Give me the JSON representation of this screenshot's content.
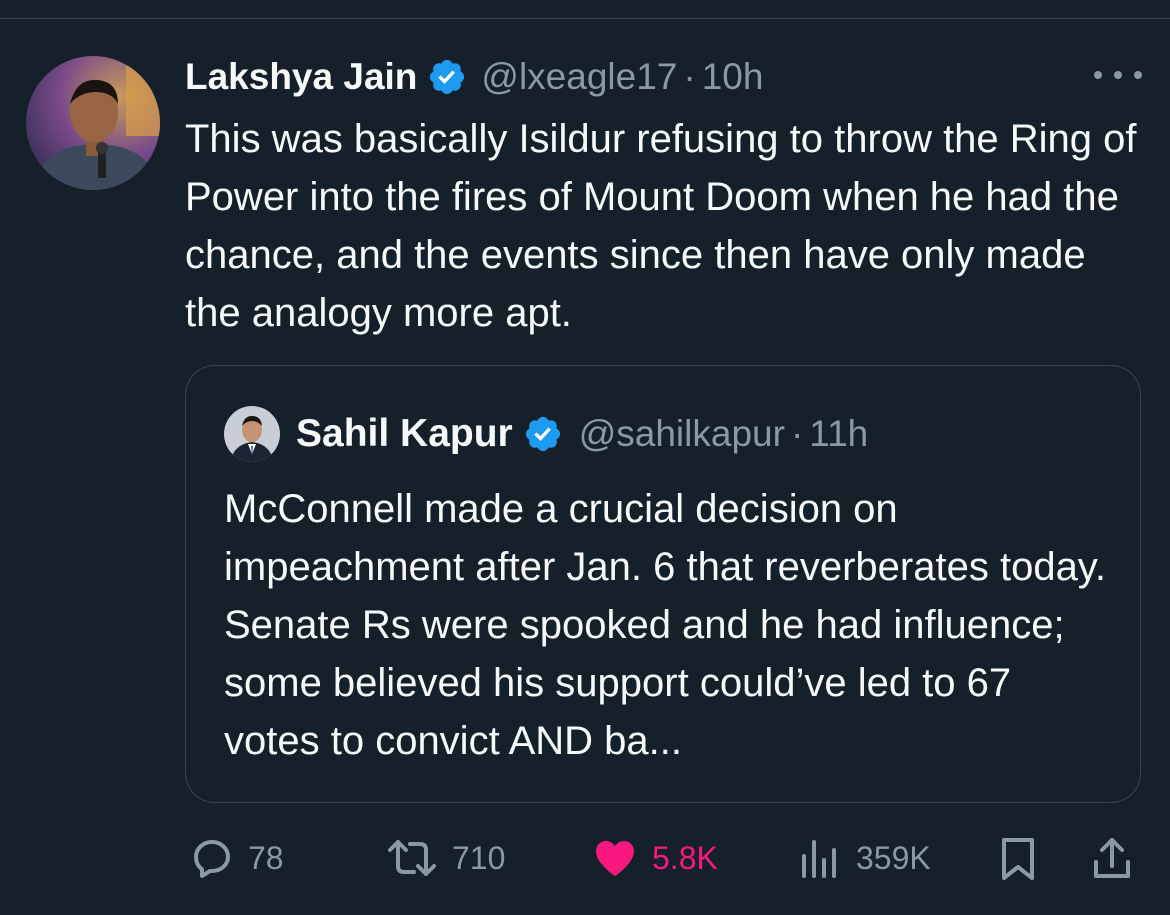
{
  "tweet": {
    "author": {
      "name": "Lakshya Jain",
      "handle": "@lxeagle17",
      "avatar_icon": "avatar-photo"
    },
    "separator": "·",
    "time": "10h",
    "text": "This was basically Isildur refusing to throw the Ring of Power into the fires of Mount Doom when he had the chance, and the events since then have only made the analogy more apt."
  },
  "quote": {
    "author": {
      "name": "Sahil Kapur",
      "handle": "@sahilkapur",
      "avatar_icon": "avatar-photo"
    },
    "separator": "·",
    "time": "11h",
    "text": "McConnell made a crucial decision on impeachment after Jan. 6 that reverberates today. Senate Rs were spooked and he had influence; some believed his support could’ve led to 67 votes to convict AND ba..."
  },
  "actions": {
    "replies": "78",
    "reposts": "710",
    "likes": "5.8K",
    "views": "359K"
  },
  "colors": {
    "background": "#15202b",
    "text": "#f7f9f9",
    "muted": "#8b98a5",
    "border": "#38444d",
    "verified": "#1d9bf0",
    "like": "#f91880"
  }
}
